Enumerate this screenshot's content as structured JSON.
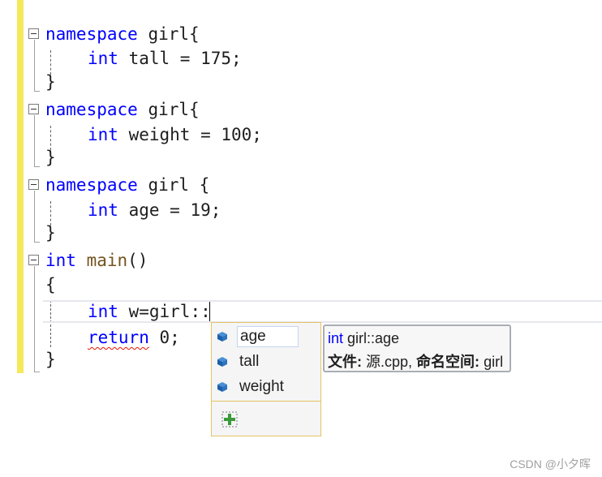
{
  "editor": {
    "lines": [
      {
        "kw": "namespace",
        "rest": " girl{"
      },
      {
        "kw": "int",
        "rest": " tall = 175;"
      },
      {
        "text": "}"
      },
      {
        "kw": "namespace",
        "rest": " girl{"
      },
      {
        "kw": "int",
        "rest": " weight = 100;"
      },
      {
        "text": "}"
      },
      {
        "kw": "namespace",
        "rest": " girl {"
      },
      {
        "kw": "int",
        "rest": " age = 19;"
      },
      {
        "text": "}"
      },
      {
        "kw": "int",
        "fn": " main",
        "rest": "()"
      },
      {
        "text": "{"
      },
      {
        "kw": "int",
        "rest": " w=girl::"
      },
      {
        "kw": "return",
        "rest": " 0;"
      },
      {
        "text": "}"
      }
    ]
  },
  "completion": {
    "items": [
      {
        "label": "age",
        "icon": "field-icon"
      },
      {
        "label": "tall",
        "icon": "field-icon"
      },
      {
        "label": "weight",
        "icon": "field-icon"
      }
    ],
    "filter_icon": "member-filter-icon"
  },
  "tooltip": {
    "type": "int",
    "name": "girl::age",
    "file_label": "文件:",
    "file_value": "源.cpp,",
    "ns_label": "命名空间:",
    "ns_value": "girl"
  },
  "watermark": "CSDN @小夕晖",
  "colors": {
    "keyword": "#0000ff",
    "function": "#74531f",
    "error_squiggle": "#e51400",
    "change_bar": "#f5e95a"
  }
}
